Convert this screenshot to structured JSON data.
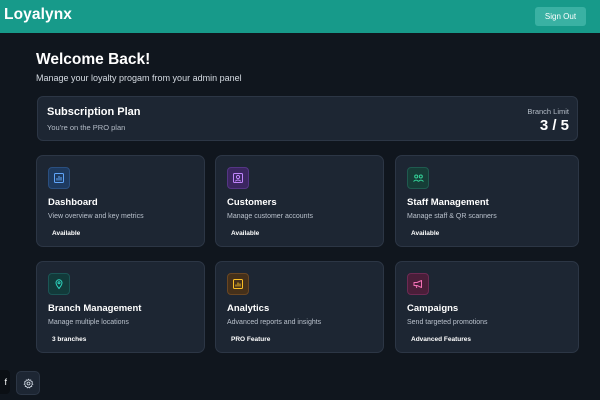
{
  "header": {
    "brand": "Loyalynx",
    "sign_out_label": "Sign Out",
    "bar_color": "#179a8a"
  },
  "welcome": {
    "title": "Welcome Back!",
    "subtitle": "Manage your loyalty progam from your admin panel"
  },
  "subscription": {
    "title": "Subscription Plan",
    "plan_text": "You're on the PRO plan",
    "limit_label": "Branch Limit",
    "limit_value": "3 / 5"
  },
  "cards": [
    {
      "title": "Dashboard",
      "description": "View overview and key metrics",
      "badge": "Available",
      "icon": "bar-chart-icon",
      "accent": "#3b82f6"
    },
    {
      "title": "Customers",
      "description": "Manage customer accounts",
      "badge": "Available",
      "icon": "user-icon",
      "accent": "#a855f7"
    },
    {
      "title": "Staff Management",
      "description": "Manage staff & QR scanners",
      "badge": "Available",
      "icon": "users-icon",
      "accent": "#10b981"
    },
    {
      "title": "Branch Management",
      "description": "Manage multiple locations",
      "badge": "3 branches",
      "icon": "map-pin-icon",
      "accent": "#14b8a6"
    },
    {
      "title": "Analytics",
      "description": "Advanced reports and insights",
      "badge": "PRO Feature",
      "icon": "chart-icon",
      "accent": "#f59e0b"
    },
    {
      "title": "Campaigns",
      "description": "Send targeted promotions",
      "badge": "Advanced Features",
      "icon": "megaphone-icon",
      "accent": "#ec4899"
    }
  ],
  "floating": {
    "facebook_label": "f",
    "settings_icon": "gear-icon"
  }
}
